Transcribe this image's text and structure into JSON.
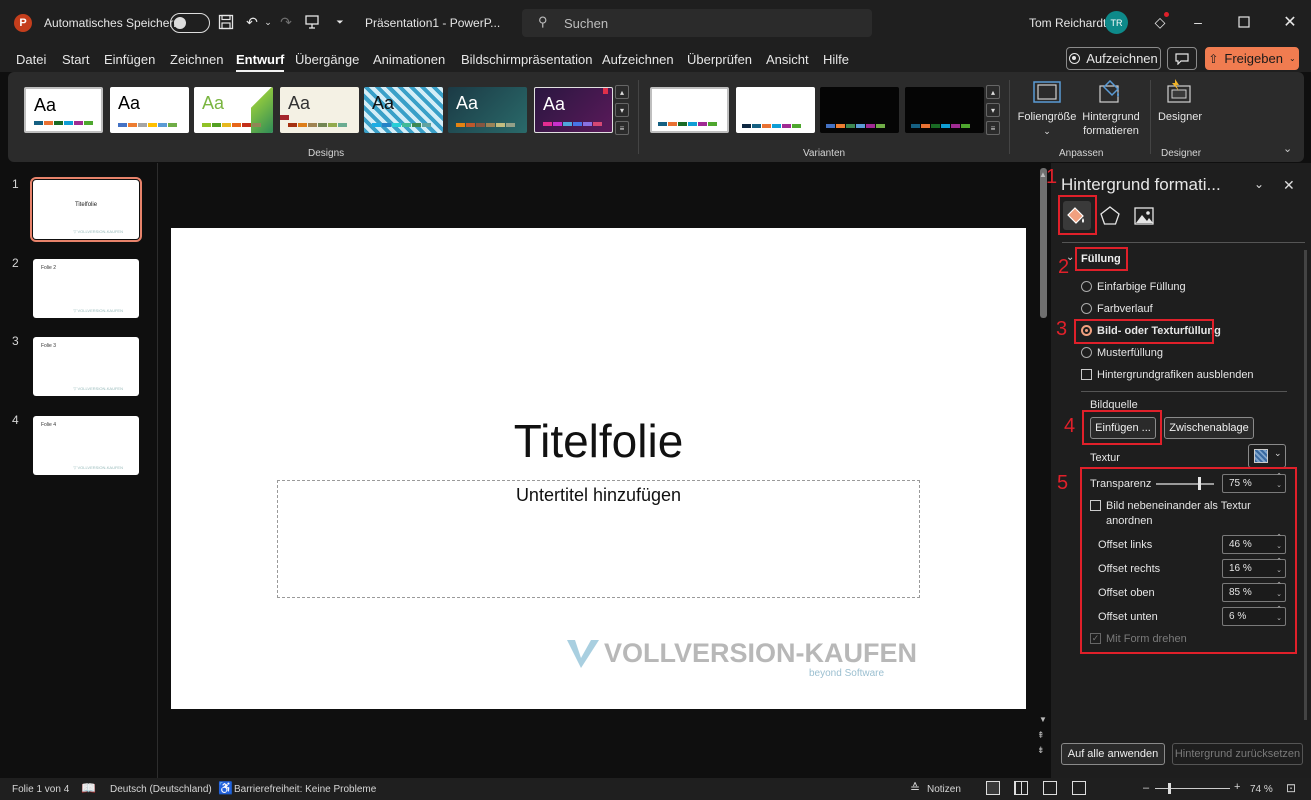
{
  "titlebar": {
    "app_icon": "powerpoint-icon",
    "autosave_label": "Automatisches Speichern",
    "doc_title": "Präsentation1  -  PowerP...",
    "search_placeholder": "Suchen",
    "user_name": "Tom Reichardt",
    "avatar_initials": "TR"
  },
  "menu": {
    "items": [
      "Datei",
      "Start",
      "Einfügen",
      "Zeichnen",
      "Entwurf",
      "Übergänge",
      "Animationen",
      "Bildschirmpräsentation",
      "Aufzeichnen",
      "Überprüfen",
      "Ansicht",
      "Hilfe"
    ],
    "active": "Entwurf",
    "record_label": "Aufzeichnen",
    "share_label": "Freigeben"
  },
  "ribbon": {
    "theme_text": "Aa",
    "designs_label": "Designs",
    "variants_label": "Varianten",
    "customize_label": "Anpassen",
    "designer_group_label": "Designer",
    "slide_size_label": "Foliengröße",
    "format_bg_label_1": "Hintergrund",
    "format_bg_label_2": "formatieren",
    "designer_label": "Designer"
  },
  "thumbnails": [
    {
      "num": "1",
      "title": "Titelfolie"
    },
    {
      "num": "2",
      "title": "Folie 2"
    },
    {
      "num": "3",
      "title": "Folie 3"
    },
    {
      "num": "4",
      "title": "Folie 4"
    }
  ],
  "slide": {
    "title": "Titelfolie",
    "subtitle_placeholder": "Untertitel hinzufügen",
    "watermark_main": "VOLLVERSION-KAUFEN",
    "watermark_sub": "beyond Software"
  },
  "pane": {
    "title": "Hintergrund formati...",
    "section_fill": "Füllung",
    "options": [
      "Einfarbige Füllung",
      "Farbverlauf",
      "Bild- oder Texturfüllung",
      "Musterfüllung"
    ],
    "selected_option": "Bild- oder Texturfüllung",
    "hide_graphics": "Hintergrundgrafiken ausblenden",
    "image_source": "Bildquelle",
    "insert_btn": "Einfügen ...",
    "clipboard_btn": "Zwischenablage",
    "texture_label": "Textur",
    "transparency_label": "Transparenz",
    "transparency_value": "75 %",
    "transparency_level": 0.75,
    "tile_label_1": "Bild nebeneinander als Textur",
    "tile_label_2": "anordnen",
    "offset_left_label": "Offset links",
    "offset_left_value": "46 %",
    "offset_right_label": "Offset rechts",
    "offset_right_value": "16 %",
    "offset_top_label": "Offset oben",
    "offset_top_value": "85 %",
    "offset_bottom_label": "Offset unten",
    "offset_bottom_value": "6 %",
    "rotate_label": "Mit Form drehen",
    "apply_all_btn": "Auf alle anwenden",
    "reset_btn": "Hintergrund zurücksetzen"
  },
  "annotations": {
    "n1": "1",
    "n2": "2",
    "n3": "3",
    "n4": "4",
    "n5": "5"
  },
  "statusbar": {
    "slide_info": "Folie 1 von 4",
    "language": "Deutsch (Deutschland)",
    "accessibility": "Barrierefreiheit: Keine Probleme",
    "notes": "Notizen",
    "zoom": "74 %"
  },
  "colors": {
    "accent": "#c43e1c",
    "share": "#f07c50",
    "annotation": "#e0202a",
    "avatar": "#0e8a8a"
  }
}
